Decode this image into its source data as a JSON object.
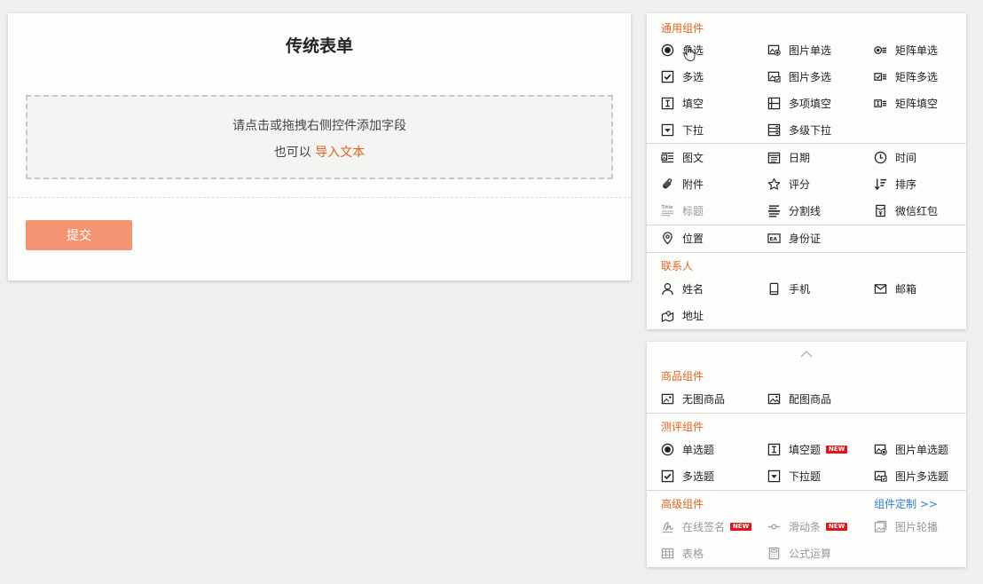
{
  "form": {
    "title": "传统表单",
    "drop_hint": "请点击或拖拽右侧控件添加字段",
    "alt_prefix": "也可以",
    "import_link": "导入文本",
    "submit_label": "提交"
  },
  "panel1": {
    "general": {
      "title": "通用组件",
      "items": [
        "单选",
        "图片单选",
        "矩阵单选",
        "多选",
        "图片多选",
        "矩阵多选",
        "填空",
        "多项填空",
        "矩阵填空",
        "下拉",
        "多级下拉"
      ]
    },
    "misc1": {
      "items": [
        "图文",
        "日期",
        "时间",
        "附件",
        "评分",
        "排序",
        "标题",
        "分割线",
        "微信红包"
      ]
    },
    "misc2": {
      "items": [
        "位置",
        "身份证"
      ]
    },
    "contact": {
      "title": "联系人",
      "items": [
        "姓名",
        "手机",
        "邮箱",
        "地址"
      ]
    }
  },
  "panel2": {
    "goods": {
      "title": "商品组件",
      "items": [
        "无图商品",
        "配图商品"
      ]
    },
    "eval": {
      "title": "测评组件",
      "items": [
        "单选题",
        "填空题",
        "图片单选题",
        "多选题",
        "下拉题",
        "图片多选题"
      ],
      "badge": "NEW"
    },
    "advanced": {
      "title": "高级组件",
      "custom_link": "组件定制 >>",
      "items": [
        "在线签名",
        "滑动条",
        "图片轮播",
        "表格",
        "公式运算"
      ],
      "badge": "NEW"
    }
  },
  "colors": {
    "accent": "#e0631f",
    "submit": "#f59472",
    "link": "#2f7fd0",
    "badge": "#e0151b"
  }
}
